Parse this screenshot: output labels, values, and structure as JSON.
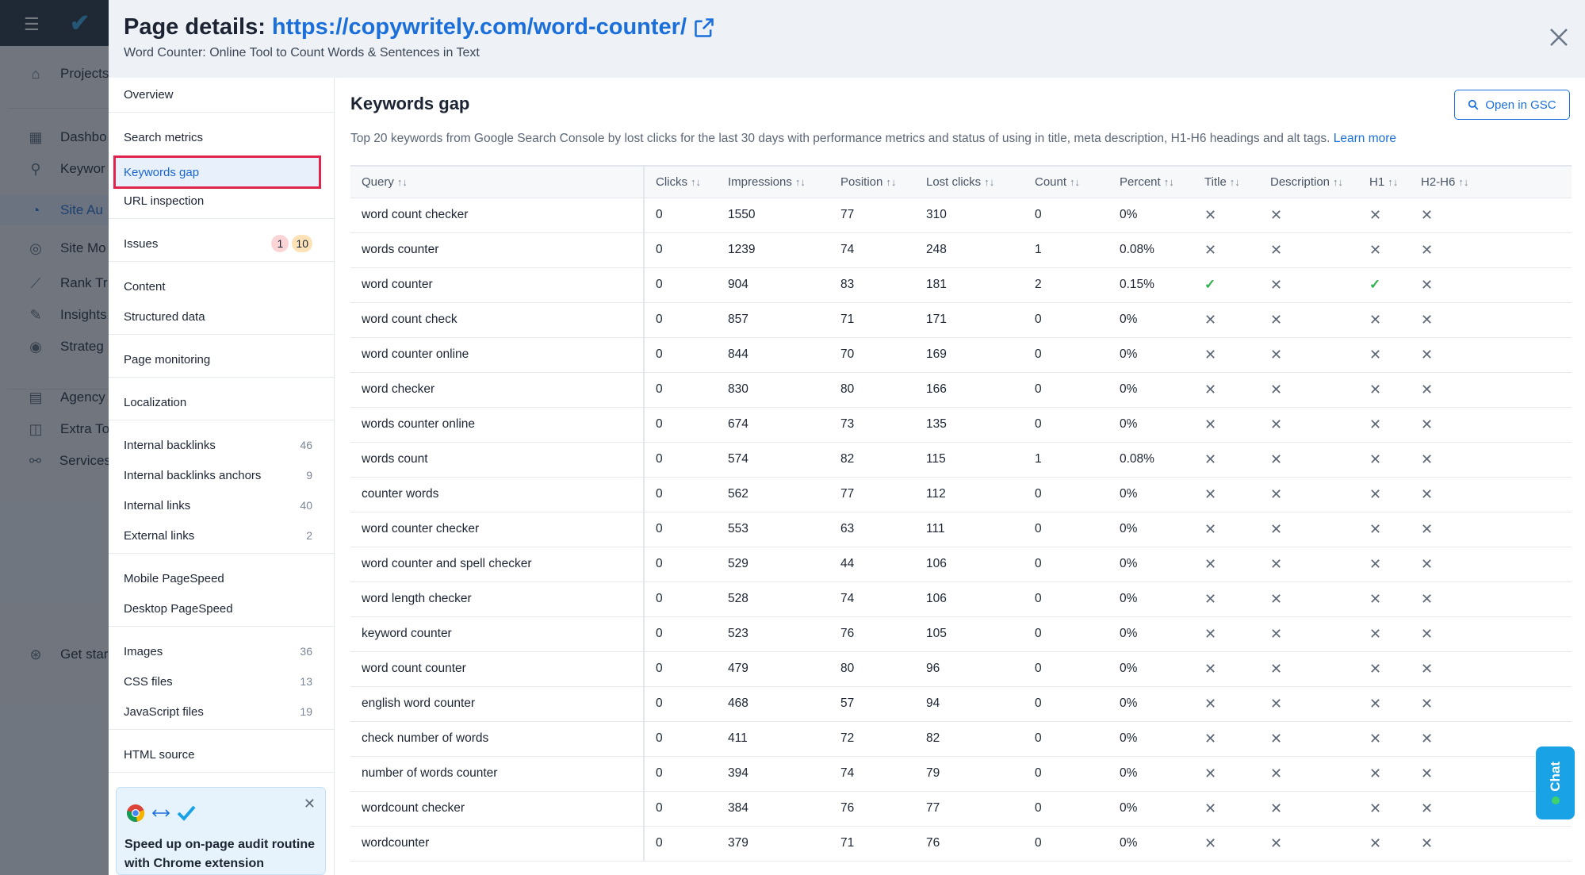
{
  "background_app": {
    "items": [
      {
        "label": "Projects",
        "icon": "home-icon"
      },
      {
        "label": "Dashbo",
        "icon": "dashboard-icon"
      },
      {
        "label": "Keywor",
        "icon": "keyword-icon"
      },
      {
        "label": "Site Au",
        "icon": "site-audit-icon"
      },
      {
        "label": "Site Mo",
        "icon": "site-monitor-icon"
      },
      {
        "label": "Rank Tr",
        "icon": "rank-tracker-icon"
      },
      {
        "label": "Insights",
        "icon": "insights-icon"
      },
      {
        "label": "Strateg",
        "icon": "strategy-icon"
      },
      {
        "label": "Agency",
        "icon": "agency-icon"
      },
      {
        "label": "Extra To",
        "icon": "extra-tools-icon"
      },
      {
        "label": "Services",
        "icon": "services-icon"
      },
      {
        "label": "Get star",
        "icon": "get-started-icon"
      }
    ]
  },
  "header": {
    "title_prefix": "Page details:",
    "url": "https://copywritely.com/word-counter/",
    "subtitle": "Word Counter: Online Tool to Count Words & Sentences in Text"
  },
  "nav": {
    "overview": "Overview",
    "search_metrics": "Search metrics",
    "keywords_gap": "Keywords gap",
    "url_inspection": "URL inspection",
    "issues": "Issues",
    "issues_badge_red": "1",
    "issues_badge_orange": "10",
    "content": "Content",
    "structured_data": "Structured data",
    "page_monitoring": "Page monitoring",
    "localization": "Localization",
    "internal_backlinks": "Internal backlinks",
    "internal_backlinks_count": "46",
    "internal_backlinks_anchors": "Internal backlinks anchors",
    "internal_backlinks_anchors_count": "9",
    "internal_links": "Internal links",
    "internal_links_count": "40",
    "external_links": "External links",
    "external_links_count": "2",
    "mobile_pagespeed": "Mobile PageSpeed",
    "desktop_pagespeed": "Desktop PageSpeed",
    "images": "Images",
    "images_count": "36",
    "css_files": "CSS files",
    "css_files_count": "13",
    "js_files": "JavaScript files",
    "js_files_count": "19",
    "html_source": "HTML source"
  },
  "promo": {
    "text": "Speed up on-page audit routine with Chrome extension"
  },
  "main": {
    "title": "Keywords gap",
    "gsc_button": "Open in GSC",
    "description": "Top 20 keywords from Google Search Console by lost clicks for the last 30 days with performance metrics and status of using in title, meta description, H1-H6 headings and alt tags.",
    "learn_more": "Learn more"
  },
  "table": {
    "columns": [
      "Query",
      "Clicks",
      "Impressions",
      "Position",
      "Lost clicks",
      "Count",
      "Percent",
      "Title",
      "Description",
      "H1",
      "H2-H6"
    ],
    "rows": [
      {
        "query": "word count checker",
        "clicks": "0",
        "impressions": "1550",
        "position": "77",
        "lost": "310",
        "count": "0",
        "percent": "0%",
        "title": "x",
        "desc": "x",
        "h1": "x",
        "h2": "x"
      },
      {
        "query": "words counter",
        "clicks": "0",
        "impressions": "1239",
        "position": "74",
        "lost": "248",
        "count": "1",
        "percent": "0.08%",
        "title": "x",
        "desc": "x",
        "h1": "x",
        "h2": "x"
      },
      {
        "query": "word counter",
        "clicks": "0",
        "impressions": "904",
        "position": "83",
        "lost": "181",
        "count": "2",
        "percent": "0.15%",
        "title": "ok",
        "desc": "x",
        "h1": "ok",
        "h2": "x"
      },
      {
        "query": "word count check",
        "clicks": "0",
        "impressions": "857",
        "position": "71",
        "lost": "171",
        "count": "0",
        "percent": "0%",
        "title": "x",
        "desc": "x",
        "h1": "x",
        "h2": "x"
      },
      {
        "query": "word counter online",
        "clicks": "0",
        "impressions": "844",
        "position": "70",
        "lost": "169",
        "count": "0",
        "percent": "0%",
        "title": "x",
        "desc": "x",
        "h1": "x",
        "h2": "x"
      },
      {
        "query": "word checker",
        "clicks": "0",
        "impressions": "830",
        "position": "80",
        "lost": "166",
        "count": "0",
        "percent": "0%",
        "title": "x",
        "desc": "x",
        "h1": "x",
        "h2": "x"
      },
      {
        "query": "words counter online",
        "clicks": "0",
        "impressions": "674",
        "position": "73",
        "lost": "135",
        "count": "0",
        "percent": "0%",
        "title": "x",
        "desc": "x",
        "h1": "x",
        "h2": "x"
      },
      {
        "query": "words count",
        "clicks": "0",
        "impressions": "574",
        "position": "82",
        "lost": "115",
        "count": "1",
        "percent": "0.08%",
        "title": "x",
        "desc": "x",
        "h1": "x",
        "h2": "x"
      },
      {
        "query": "counter words",
        "clicks": "0",
        "impressions": "562",
        "position": "77",
        "lost": "112",
        "count": "0",
        "percent": "0%",
        "title": "x",
        "desc": "x",
        "h1": "x",
        "h2": "x"
      },
      {
        "query": "word counter checker",
        "clicks": "0",
        "impressions": "553",
        "position": "63",
        "lost": "111",
        "count": "0",
        "percent": "0%",
        "title": "x",
        "desc": "x",
        "h1": "x",
        "h2": "x"
      },
      {
        "query": "word counter and spell checker",
        "clicks": "0",
        "impressions": "529",
        "position": "44",
        "lost": "106",
        "count": "0",
        "percent": "0%",
        "title": "x",
        "desc": "x",
        "h1": "x",
        "h2": "x"
      },
      {
        "query": "word length checker",
        "clicks": "0",
        "impressions": "528",
        "position": "74",
        "lost": "106",
        "count": "0",
        "percent": "0%",
        "title": "x",
        "desc": "x",
        "h1": "x",
        "h2": "x"
      },
      {
        "query": "keyword counter",
        "clicks": "0",
        "impressions": "523",
        "position": "76",
        "lost": "105",
        "count": "0",
        "percent": "0%",
        "title": "x",
        "desc": "x",
        "h1": "x",
        "h2": "x"
      },
      {
        "query": "word count counter",
        "clicks": "0",
        "impressions": "479",
        "position": "80",
        "lost": "96",
        "count": "0",
        "percent": "0%",
        "title": "x",
        "desc": "x",
        "h1": "x",
        "h2": "x"
      },
      {
        "query": "english word counter",
        "clicks": "0",
        "impressions": "468",
        "position": "57",
        "lost": "94",
        "count": "0",
        "percent": "0%",
        "title": "x",
        "desc": "x",
        "h1": "x",
        "h2": "x"
      },
      {
        "query": "check number of words",
        "clicks": "0",
        "impressions": "411",
        "position": "72",
        "lost": "82",
        "count": "0",
        "percent": "0%",
        "title": "x",
        "desc": "x",
        "h1": "x",
        "h2": "x"
      },
      {
        "query": "number of words counter",
        "clicks": "0",
        "impressions": "394",
        "position": "74",
        "lost": "79",
        "count": "0",
        "percent": "0%",
        "title": "x",
        "desc": "x",
        "h1": "x",
        "h2": "x"
      },
      {
        "query": "wordcount checker",
        "clicks": "0",
        "impressions": "384",
        "position": "76",
        "lost": "77",
        "count": "0",
        "percent": "0%",
        "title": "x",
        "desc": "x",
        "h1": "x",
        "h2": "x"
      },
      {
        "query": "wordcounter",
        "clicks": "0",
        "impressions": "379",
        "position": "71",
        "lost": "76",
        "count": "0",
        "percent": "0%",
        "title": "x",
        "desc": "x",
        "h1": "x",
        "h2": "x"
      }
    ]
  },
  "chat": {
    "label": "Chat"
  },
  "colors": {
    "accent": "#1a6fdb",
    "highlight": "#e0244c",
    "check": "#2bb24c",
    "chat": "#1aa2e6"
  }
}
